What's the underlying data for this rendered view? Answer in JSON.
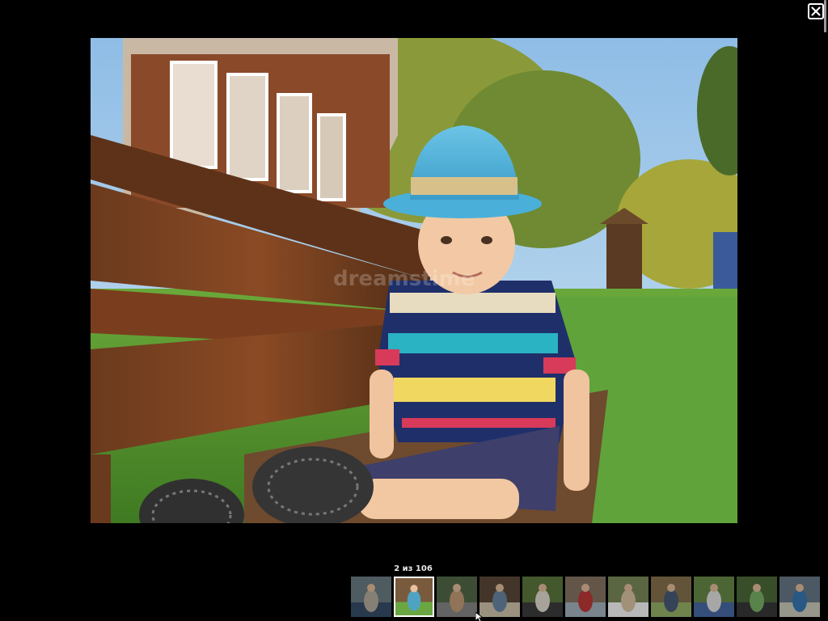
{
  "viewer": {
    "counter": "2 из 106",
    "close_icon": "close-icon",
    "main_image": {
      "subject": "boy in blue fedora and striped polo sitting on wooden bench on grass",
      "watermark": "dreamstime"
    },
    "thumbnails": [
      {
        "id": 1,
        "active": false,
        "palette": [
          "#6d7f86",
          "#b9b0a2",
          "#3a4f6b"
        ]
      },
      {
        "id": 2,
        "active": true,
        "palette": [
          "#7a5a3c",
          "#4fa3c2",
          "#6aa742"
        ]
      },
      {
        "id": 3,
        "active": false,
        "palette": [
          "#556b4a",
          "#c9a07a",
          "#8a8a8a"
        ]
      },
      {
        "id": 4,
        "active": false,
        "palette": [
          "#5e4a3a",
          "#6d8aa6",
          "#d6c9b0"
        ]
      },
      {
        "id": 5,
        "active": false,
        "palette": [
          "#5d7a3e",
          "#e8e2d6",
          "#3d3d3d"
        ]
      },
      {
        "id": 6,
        "active": false,
        "palette": [
          "#8a7866",
          "#c23a3a",
          "#aab8c4"
        ]
      },
      {
        "id": 7,
        "active": false,
        "palette": [
          "#7d8c5a",
          "#e0c9a8",
          "#ffffff"
        ]
      },
      {
        "id": 8,
        "active": false,
        "palette": [
          "#88734f",
          "#4a5d7a",
          "#9ab86a"
        ]
      },
      {
        "id": 9,
        "active": false,
        "palette": [
          "#6a8c4a",
          "#e8e8e8",
          "#4a6da8"
        ]
      },
      {
        "id": 10,
        "active": false,
        "palette": [
          "#4e6b3a",
          "#7ab86a",
          "#3a3a3a"
        ]
      },
      {
        "id": 11,
        "active": false,
        "palette": [
          "#6a7a8a",
          "#3a7ab8",
          "#d0d0c0"
        ]
      }
    ]
  }
}
